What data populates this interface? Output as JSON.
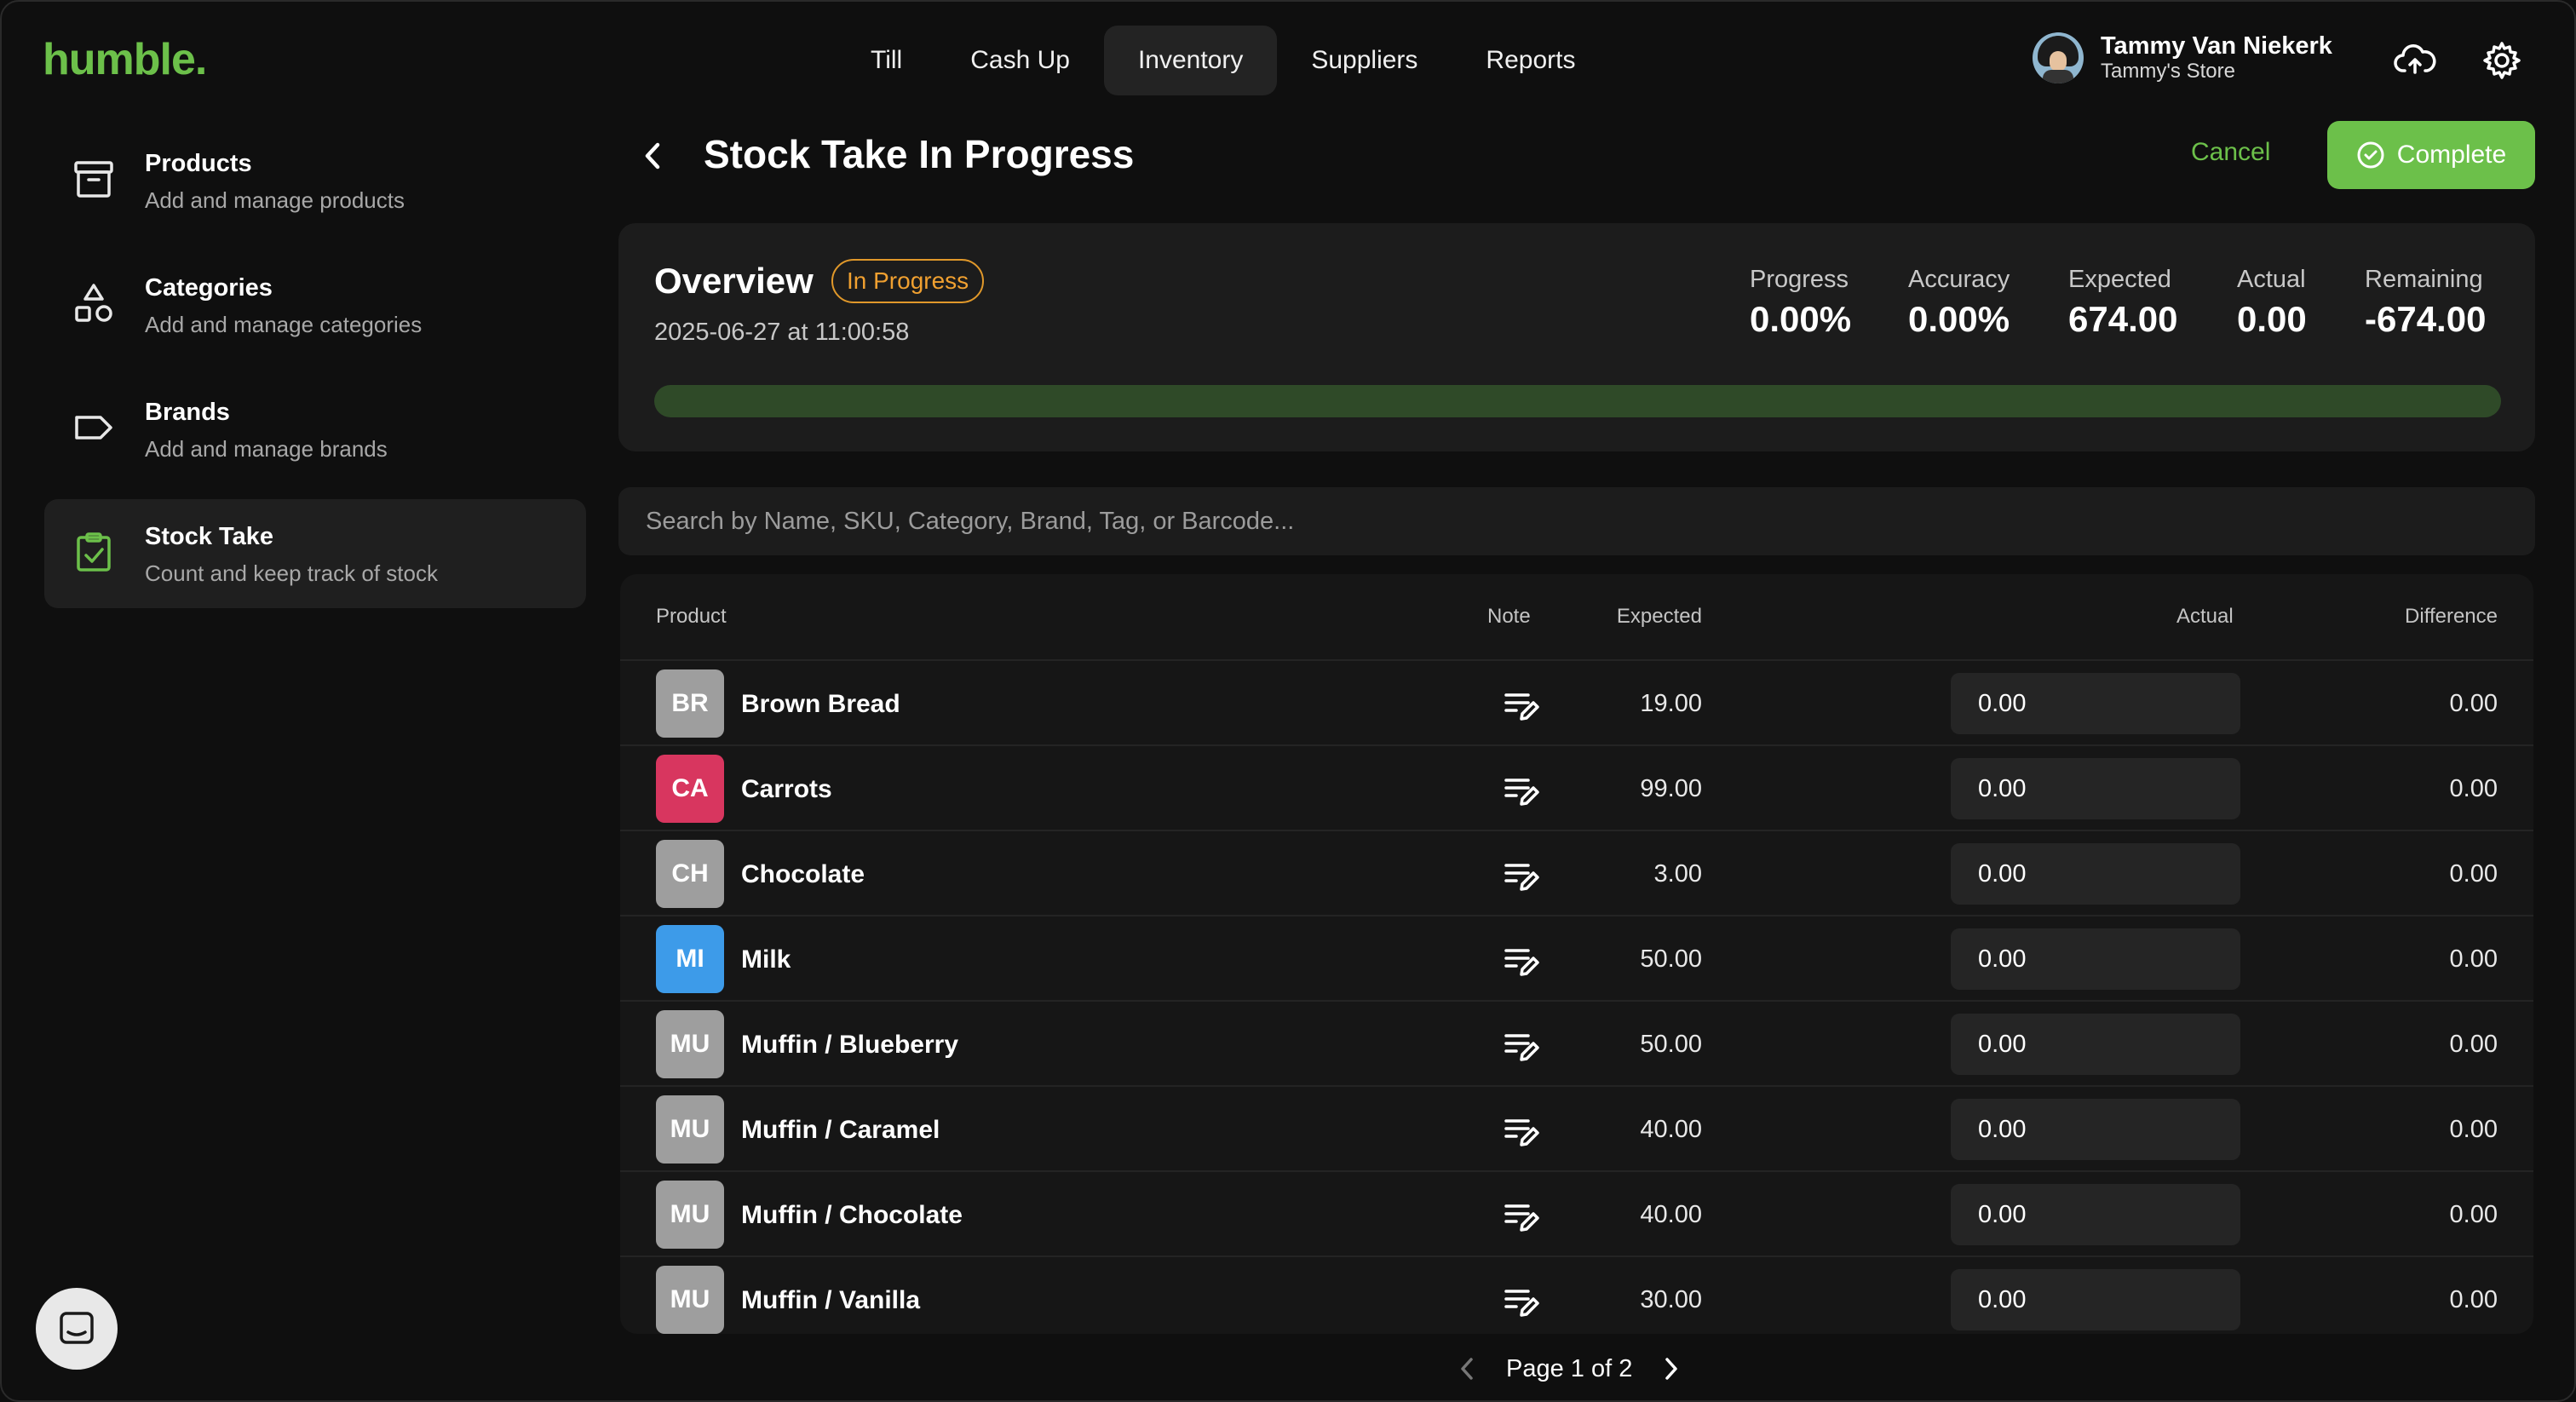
{
  "brand": {
    "logo": "humble.",
    "color": "#6cc04a"
  },
  "nav": {
    "items": [
      {
        "label": "Till"
      },
      {
        "label": "Cash Up"
      },
      {
        "label": "Inventory",
        "active": true
      },
      {
        "label": "Suppliers"
      },
      {
        "label": "Reports"
      }
    ]
  },
  "user": {
    "name": "Tammy Van Niekerk",
    "store": "Tammy's Store"
  },
  "sidebar": {
    "items": [
      {
        "title": "Products",
        "subtitle": "Add and manage products",
        "icon": "archive-icon"
      },
      {
        "title": "Categories",
        "subtitle": "Add and manage categories",
        "icon": "shapes-icon"
      },
      {
        "title": "Brands",
        "subtitle": "Add and manage brands",
        "icon": "tag-icon"
      },
      {
        "title": "Stock Take",
        "subtitle": "Count and keep track of stock",
        "icon": "clipboard-check-icon",
        "active": true
      }
    ]
  },
  "page": {
    "title": "Stock Take In Progress",
    "cancel_label": "Cancel",
    "complete_label": "Complete"
  },
  "overview": {
    "title": "Overview",
    "status": "In Progress",
    "date": "2025-06-27 at 11:00:58",
    "progress_fraction": 0,
    "stats": [
      {
        "label": "Progress",
        "value": "0.00%"
      },
      {
        "label": "Accuracy",
        "value": "0.00%"
      },
      {
        "label": "Expected",
        "value": "674.00"
      },
      {
        "label": "Actual",
        "value": "0.00"
      },
      {
        "label": "Remaining",
        "value": "-674.00"
      }
    ]
  },
  "search": {
    "placeholder": "Search by Name, SKU, Category, Brand, Tag, or Barcode..."
  },
  "table": {
    "headers": {
      "product": "Product",
      "note": "Note",
      "expected": "Expected",
      "actual": "Actual",
      "difference": "Difference"
    },
    "rows": [
      {
        "initials": "BR",
        "color": "#9e9e9e",
        "name": "Brown Bread",
        "expected": "19.00",
        "actual": "0.00",
        "difference": "0.00"
      },
      {
        "initials": "CA",
        "color": "#d8365f",
        "name": "Carrots",
        "expected": "99.00",
        "actual": "0.00",
        "difference": "0.00"
      },
      {
        "initials": "CH",
        "color": "#9e9e9e",
        "name": "Chocolate",
        "expected": "3.00",
        "actual": "0.00",
        "difference": "0.00"
      },
      {
        "initials": "MI",
        "color": "#3d9be9",
        "name": "Milk",
        "expected": "50.00",
        "actual": "0.00",
        "difference": "0.00"
      },
      {
        "initials": "MU",
        "color": "#9e9e9e",
        "name": "Muffin / Blueberry",
        "expected": "50.00",
        "actual": "0.00",
        "difference": "0.00"
      },
      {
        "initials": "MU",
        "color": "#9e9e9e",
        "name": "Muffin / Caramel",
        "expected": "40.00",
        "actual": "0.00",
        "difference": "0.00"
      },
      {
        "initials": "MU",
        "color": "#9e9e9e",
        "name": "Muffin / Chocolate",
        "expected": "40.00",
        "actual": "0.00",
        "difference": "0.00"
      },
      {
        "initials": "MU",
        "color": "#9e9e9e",
        "name": "Muffin / Vanilla",
        "expected": "30.00",
        "actual": "0.00",
        "difference": "0.00"
      }
    ]
  },
  "pagination": {
    "label": "Page 1 of 2"
  }
}
